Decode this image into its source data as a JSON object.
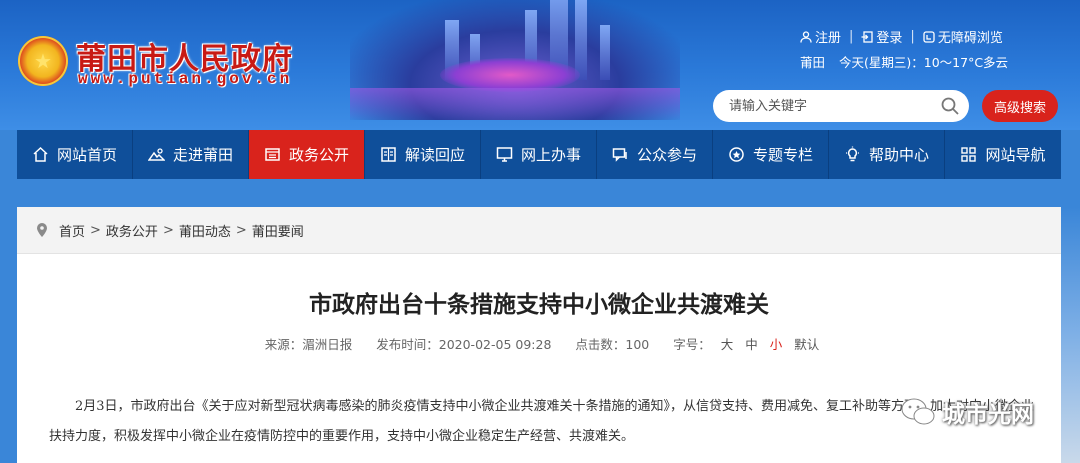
{
  "header": {
    "site_name": "莆田市人民政府",
    "site_url": "www.putian.gov.cn",
    "top_links": {
      "register": "注册",
      "login": "登录",
      "accessible": "无障碍浏览"
    },
    "weather": {
      "city": "莆田",
      "text": "今天(星期三)：10～17°C多云"
    },
    "search": {
      "placeholder": "请输入关键字"
    },
    "advanced_search": "高级搜索"
  },
  "nav": {
    "items": [
      {
        "label": "网站首页",
        "icon": "home-icon"
      },
      {
        "label": "走进莆田",
        "icon": "landscape-icon"
      },
      {
        "label": "政务公开",
        "icon": "document-icon"
      },
      {
        "label": "解读回应",
        "icon": "book-icon"
      },
      {
        "label": "网上办事",
        "icon": "monitor-icon"
      },
      {
        "label": "公众参与",
        "icon": "chat-icon"
      },
      {
        "label": "专题专栏",
        "icon": "badge-icon"
      },
      {
        "label": "帮助中心",
        "icon": "lightbulb-icon"
      },
      {
        "label": "网站导航",
        "icon": "grid-icon"
      }
    ],
    "active_index": 2
  },
  "breadcrumb": [
    "首页",
    "政务公开",
    "莆田动态",
    "莆田要闻"
  ],
  "breadcrumb_separator": ">",
  "article": {
    "title": "市政府出台十条措施支持中小微企业共渡难关",
    "source_label": "来源：湄洲日报",
    "time_label": "发布时间：2020-02-05 09:28",
    "views_label": "点击数：100",
    "font_size_label": "字号：",
    "font_sizes": [
      "大",
      "中",
      "小",
      "默认"
    ],
    "paragraph": "2月3日，市政府出台《关于应对新型冠状病毒感染的肺炎疫情支持中小微企业共渡难关十条措施的通知》，从信贷支持、费用减免、复工补助等方面，加大对中小微企业扶持力度，积极发挥中小微企业在疫情防控中的重要作用，支持中小微企业稳定生产经营、共渡难关。"
  },
  "watermark": "城市光网",
  "colors": {
    "header_blue": "#2b7ad9",
    "nav_blue": "#0f4f9a",
    "accent_red": "#d9231c"
  }
}
